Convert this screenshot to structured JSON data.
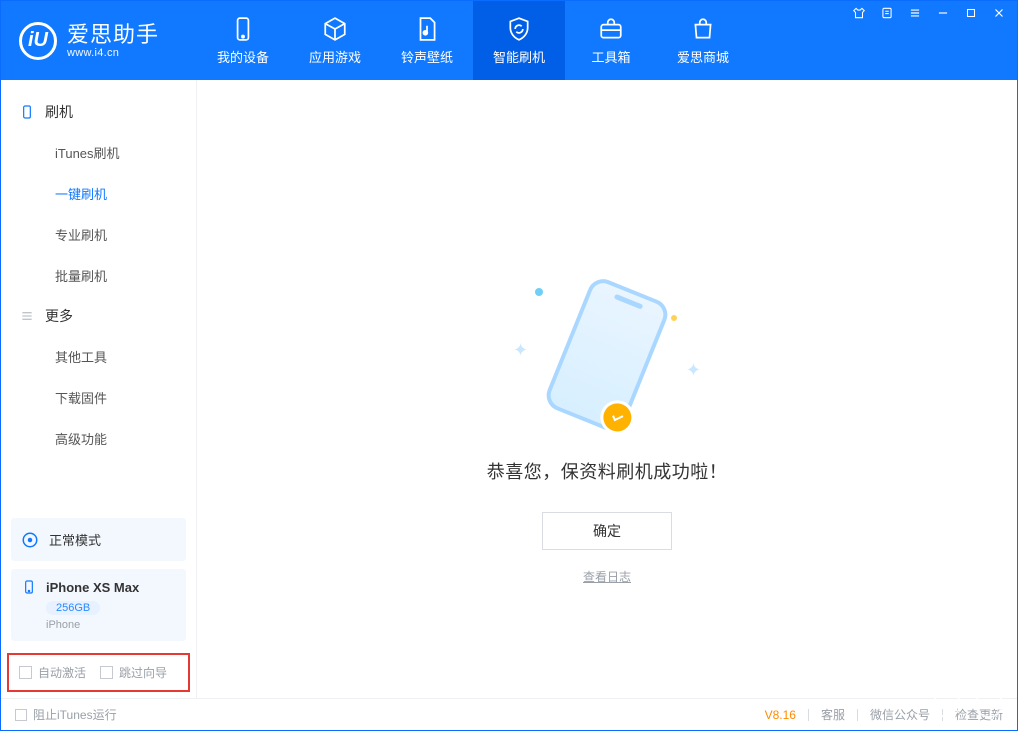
{
  "logo": {
    "title": "爱思助手",
    "url": "www.i4.cn",
    "mark": "iU"
  },
  "tabs": {
    "device": "我的设备",
    "apps": "应用游戏",
    "ring": "铃声壁纸",
    "flash": "智能刷机",
    "toolbox": "工具箱",
    "store": "爱思商城"
  },
  "sidebar": {
    "group_flash": "刷机",
    "items_flash": {
      "itunes": "iTunes刷机",
      "onekey": "一键刷机",
      "pro": "专业刷机",
      "batch": "批量刷机"
    },
    "group_more": "更多",
    "items_more": {
      "other": "其他工具",
      "firmware": "下载固件",
      "adv": "高级功能"
    },
    "status": "正常模式",
    "device": {
      "name": "iPhone XS Max",
      "capacity": "256GB",
      "type": "iPhone"
    },
    "checks": {
      "auto_activate": "自动激活",
      "skip_wizard": "跳过向导"
    }
  },
  "main": {
    "success": "恭喜您，保资料刷机成功啦！",
    "ok": "确定",
    "viewlog": "查看日志"
  },
  "footer": {
    "block_itunes": "阻止iTunes运行",
    "version": "V8.16",
    "support": "客服",
    "wechat": "微信公众号",
    "update": "检查更新"
  }
}
